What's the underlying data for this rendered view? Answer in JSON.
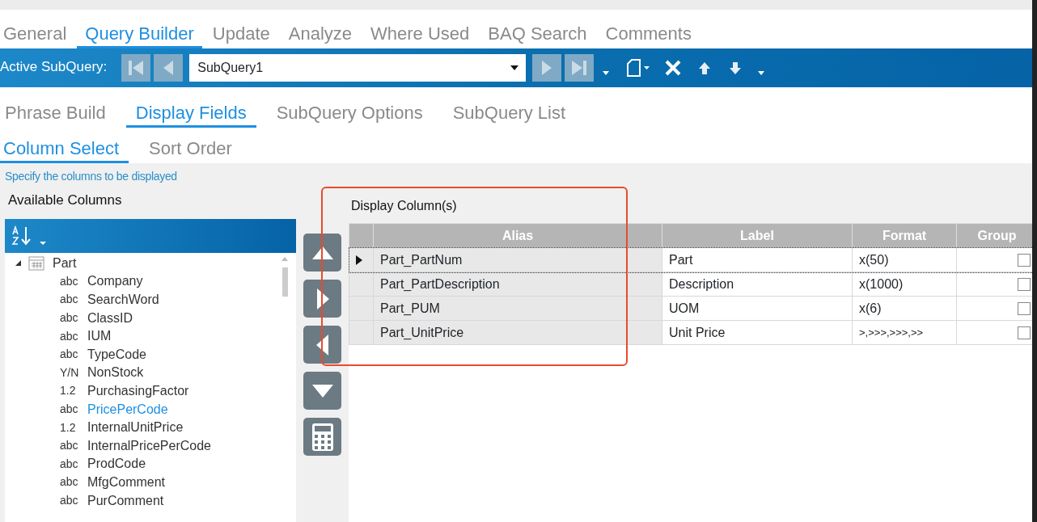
{
  "main_tabs": [
    {
      "label": "General",
      "selected": false
    },
    {
      "label": "Query Builder",
      "selected": true
    },
    {
      "label": "Update",
      "selected": false
    },
    {
      "label": "Analyze",
      "selected": false
    },
    {
      "label": "Where Used",
      "selected": false
    },
    {
      "label": "BAQ Search",
      "selected": false
    },
    {
      "label": "Comments",
      "selected": false
    }
  ],
  "toolbar": {
    "label": "Active SubQuery:",
    "subquery": "SubQuery1"
  },
  "sub_tabs": [
    {
      "label": "Phrase Build",
      "selected": false
    },
    {
      "label": "Display Fields",
      "selected": true
    },
    {
      "label": "SubQuery Options",
      "selected": false
    },
    {
      "label": "SubQuery List",
      "selected": false
    }
  ],
  "field_tabs": [
    {
      "label": "Column Select",
      "selected": true
    },
    {
      "label": "Sort Order",
      "selected": false
    }
  ],
  "hint": "Specify the columns to be displayed",
  "available": {
    "title": "Available Columns",
    "table": "Part",
    "expanded": true,
    "columns": [
      {
        "type": "abc",
        "name": "Company",
        "selected": false
      },
      {
        "type": "abc",
        "name": "SearchWord",
        "selected": false
      },
      {
        "type": "abc",
        "name": "ClassID",
        "selected": false
      },
      {
        "type": "abc",
        "name": "IUM",
        "selected": false
      },
      {
        "type": "abc",
        "name": "TypeCode",
        "selected": false
      },
      {
        "type": "Y/N",
        "name": "NonStock",
        "selected": false
      },
      {
        "type": "1.2",
        "name": "PurchasingFactor",
        "selected": false
      },
      {
        "type": "abc",
        "name": "PricePerCode",
        "selected": true
      },
      {
        "type": "1.2",
        "name": "InternalUnitPrice",
        "selected": false
      },
      {
        "type": "abc",
        "name": "InternalPricePerCode",
        "selected": false
      },
      {
        "type": "abc",
        "name": "ProdCode",
        "selected": false
      },
      {
        "type": "abc",
        "name": "MfgComment",
        "selected": false
      },
      {
        "type": "abc",
        "name": "PurComment",
        "selected": false
      }
    ]
  },
  "display": {
    "title": "Display Column(s)",
    "columns": [
      "Alias",
      "Label",
      "Format",
      "Group"
    ],
    "rows": [
      {
        "alias": "Part_PartNum",
        "label": "Part",
        "format": "x(50)",
        "group": false,
        "current": true
      },
      {
        "alias": "Part_PartDescription",
        "label": "Description",
        "format": "x(1000)",
        "group": false,
        "current": false
      },
      {
        "alias": "Part_PUM",
        "label": "UOM",
        "format": "x(6)",
        "group": false,
        "current": false
      },
      {
        "alias": "Part_UnitPrice",
        "label": "Unit Price",
        "format": ">,>>>,>>>,>>",
        "group": false,
        "current": false
      }
    ]
  }
}
